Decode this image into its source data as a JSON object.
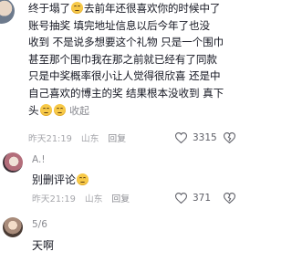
{
  "comments": [
    {
      "lines": [
        "终于塌了",
        "去前年还很喜欢你的时候中了",
        "账号抽奖 填完地址信息以后今年了也没",
        "收到 不是说多想要这个礼物 只是一个围巾",
        "甚至那个围巾我在那之前就已经有了同款",
        "只是中奖概率很小让人觉得很欣喜 还是中",
        "自己喜欢的博主的奖 结果根本没收到 真下",
        "头"
      ],
      "collapse": "收起",
      "time": "昨天21:19",
      "location": "山东",
      "reply": "回复",
      "likes": "3315"
    },
    {
      "name": "A.!",
      "text": "别删评论",
      "time": "昨天21:19",
      "location": "山东",
      "reply": "回复",
      "likes": "371"
    },
    {
      "name": "5/6",
      "text": "天啊"
    }
  ],
  "icons": {
    "heart": "heart-icon",
    "dislike": "dislike-icon"
  }
}
